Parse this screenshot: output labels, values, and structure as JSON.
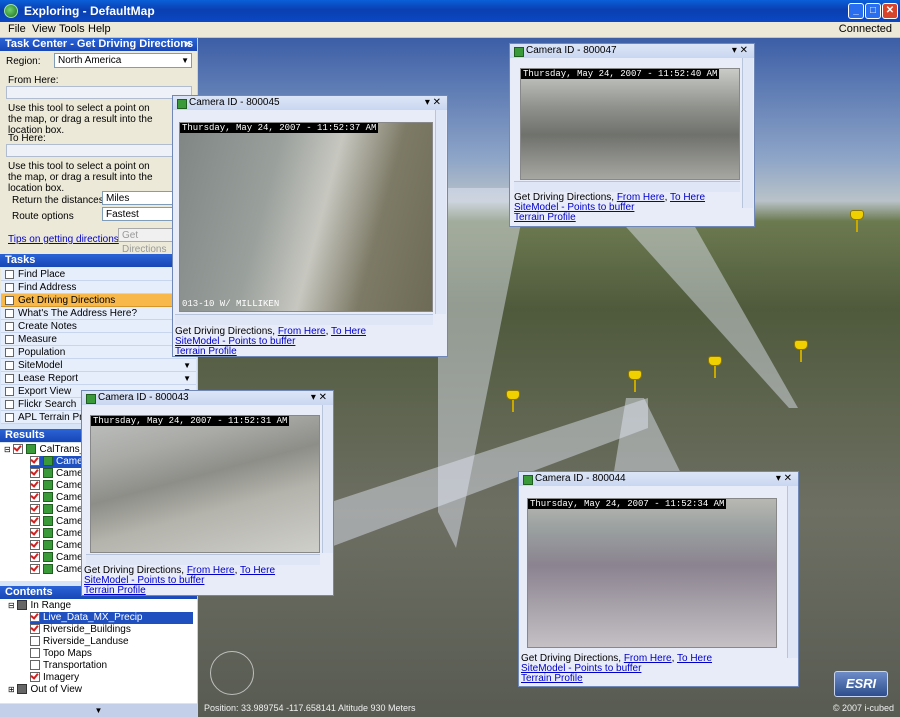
{
  "window": {
    "title": "Exploring - DefaultMap",
    "min": "_",
    "max": "□",
    "close": "✕"
  },
  "menu": {
    "items": [
      "File",
      "View",
      "Tools",
      "Help"
    ],
    "status": "Connected"
  },
  "task_center": {
    "title": "Task Center - Get Driving Directions",
    "region_label": "Region:",
    "region_value": "North America",
    "from_label": "From Here:",
    "from_help": "Use this tool to select a point on the map, or drag a result into the location box.",
    "to_label": "To Here:",
    "to_help": "Use this tool to select a point on the map, or drag a result into the location box.",
    "distance_label": "Return the distances in",
    "distance_value": "Miles",
    "route_label": "Route options",
    "route_value": "Fastest",
    "tips_link": "Tips on getting directions",
    "go_button": "Get Directions"
  },
  "tasks": {
    "title": "Tasks",
    "items": [
      "Find Place",
      "Find Address",
      "Get Driving Directions",
      "What's The Address Here?",
      "Create Notes",
      "Measure",
      "Population",
      "SiteModel",
      "Lease Report",
      "Export View",
      "Flickr Search",
      "APL Terrain Profile"
    ]
  },
  "results": {
    "title": "Results",
    "root": "CalTrans_A",
    "items": [
      "Camera",
      "Camera",
      "Camera",
      "Camera",
      "Camera",
      "Camera",
      "Camera",
      "Camera",
      "Camera",
      "Camera",
      "Camera"
    ]
  },
  "contents": {
    "title": "Contents",
    "in_range": "In Range",
    "layers": [
      "Live_Data_MX_Precip",
      "Riverside_Buildings",
      "Riverside_Landuse",
      "Topo Maps",
      "Transportation",
      "Imagery"
    ],
    "out_of_view": "Out of View"
  },
  "map": {
    "status": "Position: 33.989754  -117.658141  Altitude 930 Meters",
    "copyright": "© 2007 i-cubed",
    "logo": "ESRI"
  },
  "popups": [
    {
      "title": "Camera ID - 800045",
      "timestamp": "Thursday, May 24, 2007 - 11:52:37 AM",
      "overlay": "013-10 W/ MILLIKEN"
    },
    {
      "title": "Camera ID - 800047",
      "timestamp": "Thursday, May 24, 2007 - 11:52:40 AM",
      "overlay": ""
    },
    {
      "title": "Camera ID - 800043",
      "timestamp": "Thursday, May 24, 2007 - 11:52:31 AM",
      "overlay": ""
    },
    {
      "title": "Camera ID - 800044",
      "timestamp": "Thursday, May 24, 2007 - 11:52:34 AM",
      "overlay": ""
    }
  ],
  "popup_links": {
    "directions": "Get Driving Directions,",
    "from": "From Here",
    "to": "To Here",
    "sitemodel": "SiteModel - Points to buffer",
    "terrain": "Terrain Profile"
  }
}
